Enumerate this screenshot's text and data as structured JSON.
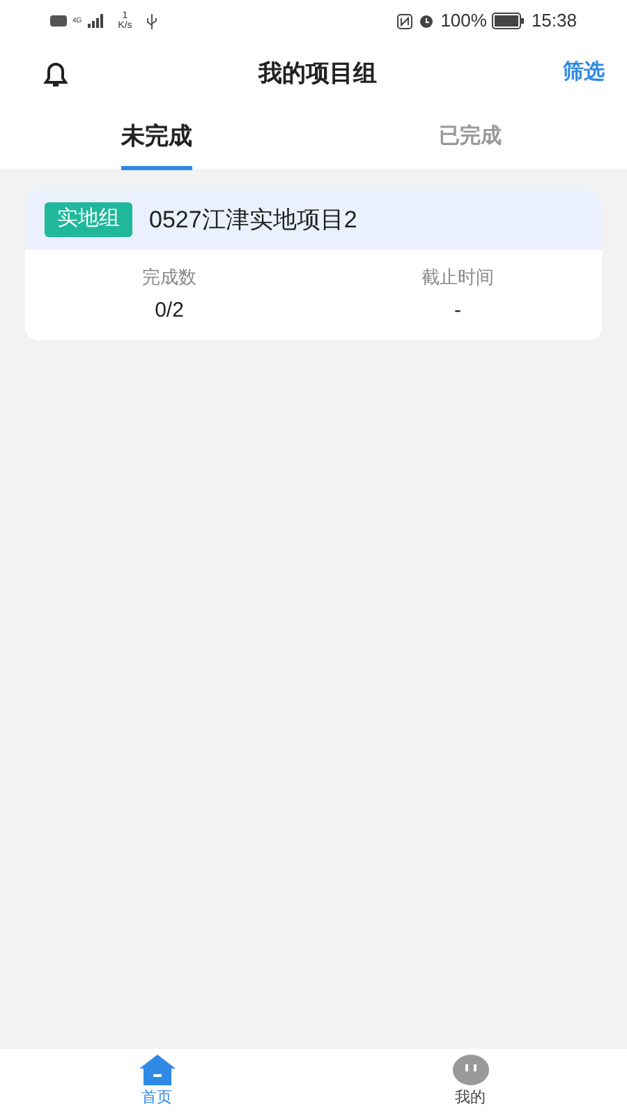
{
  "status_bar": {
    "network": "4G",
    "speed_value": "1",
    "speed_unit": "K/s",
    "battery": "100%",
    "time": "15:38"
  },
  "header": {
    "title": "我的项目组",
    "filter": "筛选"
  },
  "tabs": [
    {
      "label": "未完成",
      "selected": true
    },
    {
      "label": "已完成",
      "selected": false
    }
  ],
  "projects": [
    {
      "tag": "实地组",
      "name": "0527江津实地项目2",
      "stats": [
        {
          "label": "完成数",
          "value": "0/2"
        },
        {
          "label": "截止时间",
          "value": "-"
        }
      ]
    }
  ],
  "bottom_nav": [
    {
      "label": "首页",
      "kind": "home",
      "selected": true
    },
    {
      "label": "我的",
      "kind": "profile",
      "selected": false
    }
  ]
}
